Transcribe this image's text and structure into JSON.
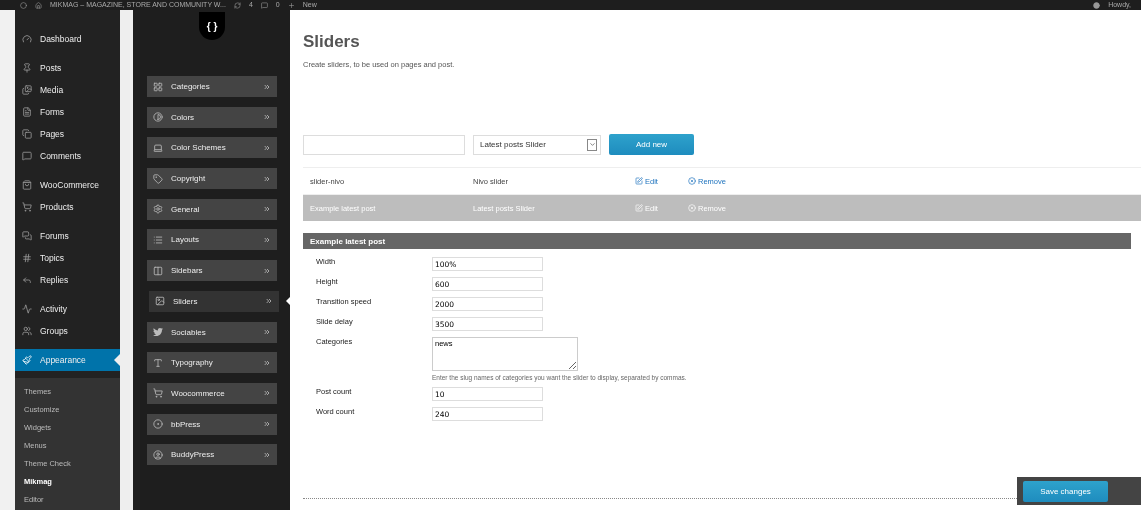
{
  "admin_bar": {
    "site_title": "MIKMAG – MAGAZINE, STORE AND COMMUNITY W...",
    "updates": "4",
    "comments": "0",
    "new": "New",
    "greeting": "Howdy,"
  },
  "admin_menu": {
    "groups": [
      {
        "items": [
          {
            "label": "Dashboard",
            "selected": false
          }
        ]
      },
      {
        "items": [
          {
            "label": "Posts",
            "selected": false
          },
          {
            "label": "Media",
            "selected": false
          },
          {
            "label": "Forms",
            "selected": false
          },
          {
            "label": "Pages",
            "selected": false
          },
          {
            "label": "Comments",
            "selected": false
          }
        ]
      },
      {
        "items": [
          {
            "label": "WooCommerce",
            "selected": false
          },
          {
            "label": "Products",
            "selected": false
          }
        ]
      },
      {
        "items": [
          {
            "label": "Forums",
            "selected": false
          },
          {
            "label": "Topics",
            "selected": false
          },
          {
            "label": "Replies",
            "selected": false
          }
        ]
      },
      {
        "items": [
          {
            "label": "Activity",
            "selected": false
          },
          {
            "label": "Groups",
            "selected": false
          }
        ]
      },
      {
        "items": [
          {
            "label": "Appearance",
            "selected": true
          }
        ]
      }
    ],
    "submenu": [
      {
        "label": "Themes",
        "selected": false
      },
      {
        "label": "Customize",
        "selected": false
      },
      {
        "label": "Widgets",
        "selected": false
      },
      {
        "label": "Menus",
        "selected": false
      },
      {
        "label": "Theme Check",
        "selected": false
      },
      {
        "label": "Mikmag",
        "selected": true
      },
      {
        "label": "Editor",
        "selected": false
      }
    ]
  },
  "theme_nav": {
    "logo": "{ }",
    "items": [
      {
        "label": "Categories",
        "selected": false
      },
      {
        "label": "Colors",
        "selected": false
      },
      {
        "label": "Color Schemes",
        "selected": false
      },
      {
        "label": "Copyright",
        "selected": false
      },
      {
        "label": "General",
        "selected": false
      },
      {
        "label": "Layouts",
        "selected": false
      },
      {
        "label": "Sidebars",
        "selected": false
      },
      {
        "label": "Sliders",
        "selected": true
      },
      {
        "label": "Sociables",
        "selected": false
      },
      {
        "label": "Typography",
        "selected": false
      },
      {
        "label": "Woocommerce",
        "selected": false
      },
      {
        "label": "bbPress",
        "selected": false
      },
      {
        "label": "BuddyPress",
        "selected": false
      }
    ]
  },
  "page": {
    "title": "Sliders",
    "description": "Create sliders, to be used on pages and post.",
    "add_form": {
      "type_value": "Latest posts Slider",
      "add_button": "Add new"
    },
    "sliders": [
      {
        "name": "slider-nivo",
        "type": "Nivo slider",
        "edit": "Edit",
        "remove": "Remove",
        "selected": false
      },
      {
        "name": "Example latest post",
        "type": "Latest posts Slider",
        "edit": "Edit",
        "remove": "Remove",
        "selected": true
      }
    ],
    "settings": {
      "title": "Example latest post",
      "fields": [
        {
          "kind": "input",
          "label": "Width",
          "value": "100%"
        },
        {
          "kind": "input",
          "label": "Height",
          "value": "600"
        },
        {
          "kind": "input",
          "label": "Transition speed",
          "value": "2000"
        },
        {
          "kind": "input",
          "label": "Slide delay",
          "value": "3500"
        },
        {
          "kind": "textarea",
          "label": "Categories",
          "value": "news",
          "help": "Enter the slug names of categories you want the slider to display, separated by commas."
        },
        {
          "kind": "input",
          "label": "Post count",
          "value": "10"
        },
        {
          "kind": "input",
          "label": "Word count",
          "value": "240"
        }
      ]
    },
    "save_button": "Save changes"
  }
}
